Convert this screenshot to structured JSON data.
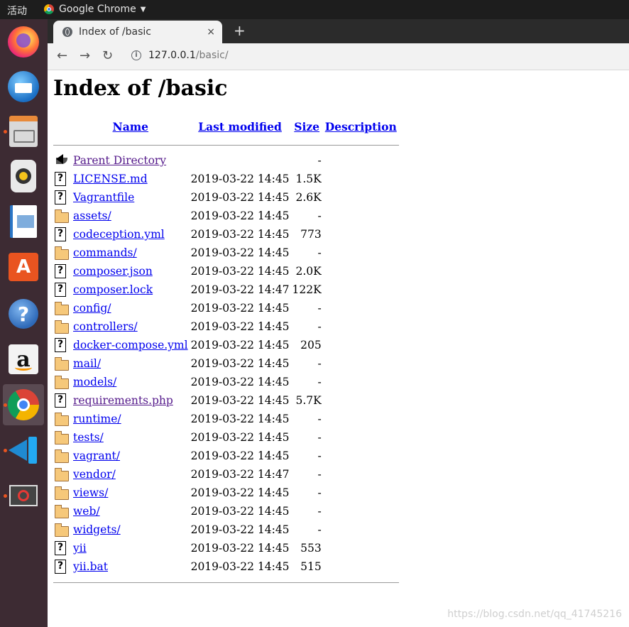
{
  "topbar": {
    "activities": "活动",
    "app_name": "Google Chrome"
  },
  "dock": {
    "items": [
      "firefox-icon",
      "thunderbird-icon",
      "files-icon",
      "rhythmbox-icon",
      "libreoffice-writer-icon",
      "software-center-icon",
      "help-icon",
      "amazon-icon",
      "chrome-icon",
      "vscode-icon",
      "screen-icon"
    ]
  },
  "browser": {
    "tab_title": "Index of /basic",
    "tab_close": "×",
    "new_tab": "+",
    "back": "←",
    "forward": "→",
    "reload": "↻",
    "url_host": "127.0.0.1",
    "url_path": "/basic/"
  },
  "page": {
    "heading": "Index of /basic",
    "columns": {
      "name": "Name",
      "last_modified": "Last modified",
      "size": "Size",
      "description": "Description"
    },
    "parent": {
      "name": "Parent Directory",
      "size": "-"
    },
    "entries": [
      {
        "name": "LICENSE.md",
        "modified": "2019-03-22 14:45",
        "size": "1.5K"
      },
      {
        "name": "Vagrantfile",
        "modified": "2019-03-22 14:45",
        "size": "2.6K"
      },
      {
        "name": "assets/",
        "modified": "2019-03-22 14:45",
        "size": "-"
      },
      {
        "name": "codeception.yml",
        "modified": "2019-03-22 14:45",
        "size": "773"
      },
      {
        "name": "commands/",
        "modified": "2019-03-22 14:45",
        "size": "-"
      },
      {
        "name": "composer.json",
        "modified": "2019-03-22 14:45",
        "size": "2.0K"
      },
      {
        "name": "composer.lock",
        "modified": "2019-03-22 14:47",
        "size": "122K"
      },
      {
        "name": "config/",
        "modified": "2019-03-22 14:45",
        "size": "-"
      },
      {
        "name": "controllers/",
        "modified": "2019-03-22 14:45",
        "size": "-"
      },
      {
        "name": "docker-compose.yml",
        "modified": "2019-03-22 14:45",
        "size": "205"
      },
      {
        "name": "mail/",
        "modified": "2019-03-22 14:45",
        "size": "-"
      },
      {
        "name": "models/",
        "modified": "2019-03-22 14:45",
        "size": "-"
      },
      {
        "name": "requirements.php",
        "modified": "2019-03-22 14:45",
        "size": "5.7K"
      },
      {
        "name": "runtime/",
        "modified": "2019-03-22 14:45",
        "size": "-"
      },
      {
        "name": "tests/",
        "modified": "2019-03-22 14:45",
        "size": "-"
      },
      {
        "name": "vagrant/",
        "modified": "2019-03-22 14:45",
        "size": "-"
      },
      {
        "name": "vendor/",
        "modified": "2019-03-22 14:47",
        "size": "-"
      },
      {
        "name": "views/",
        "modified": "2019-03-22 14:45",
        "size": "-"
      },
      {
        "name": "web/",
        "modified": "2019-03-22 14:45",
        "size": "-"
      },
      {
        "name": "widgets/",
        "modified": "2019-03-22 14:45",
        "size": "-"
      },
      {
        "name": "yii",
        "modified": "2019-03-22 14:45",
        "size": "553"
      },
      {
        "name": "yii.bat",
        "modified": "2019-03-22 14:45",
        "size": "515"
      }
    ]
  },
  "watermark": "https://blog.csdn.net/qq_41745216"
}
